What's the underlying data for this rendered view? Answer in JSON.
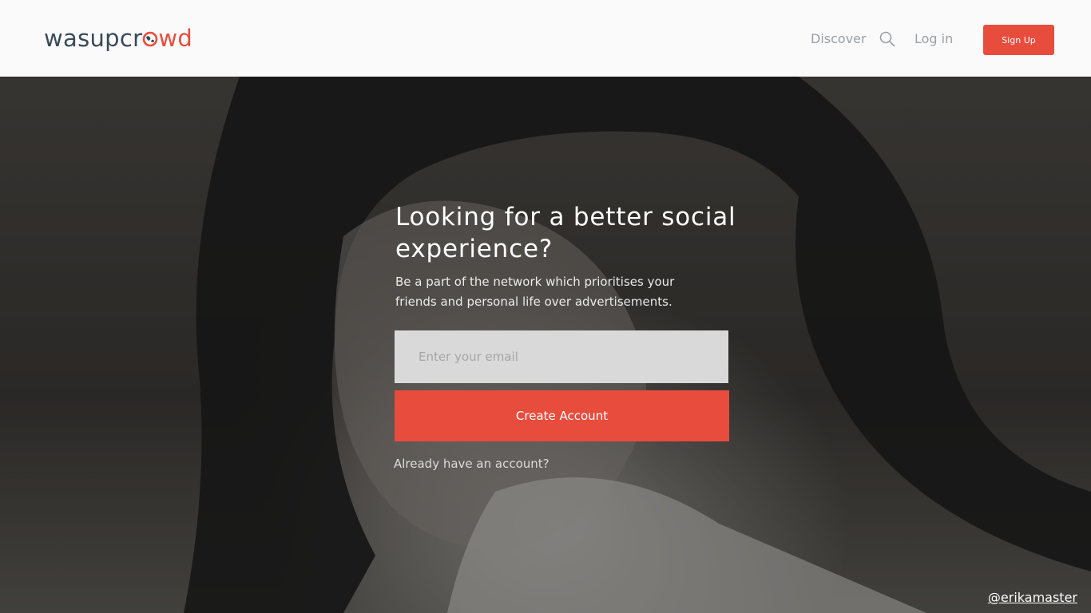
{
  "header": {
    "logo_part1": "wasupcr",
    "logo_part2": "wd",
    "nav": {
      "discover_label": "Discover",
      "login_label": "Log in",
      "signup_label": "Sign Up"
    }
  },
  "hero": {
    "headline": "Looking for a better social experience?",
    "subtext": "Be a part of the network which prioritises your friends and personal life over advertisements.",
    "email_placeholder": "Enter your email",
    "create_button_label": "Create Account",
    "already_link_label": "Already have an account?",
    "photo_credit": "@erikamaster"
  },
  "icons": {
    "search": "search-icon",
    "logo_globe": "globe-icon"
  },
  "colors": {
    "accent": "#e84c3d",
    "logo_dark": "#3a4a57",
    "nav_text": "#9aa0a6",
    "input_bg": "#d9d9d9"
  }
}
